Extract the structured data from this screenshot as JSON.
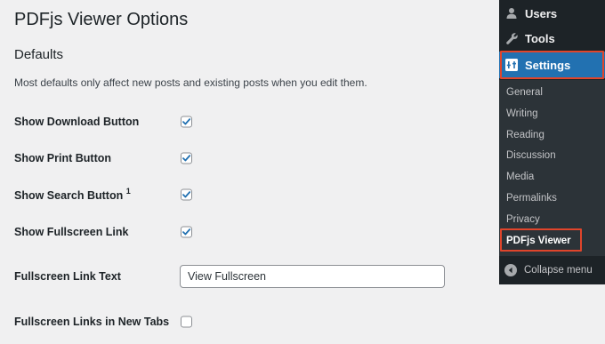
{
  "page": {
    "title": "PDFjs Viewer Options",
    "section_title": "Defaults",
    "section_description": "Most defaults only affect new posts and existing posts when you edit them."
  },
  "settings": [
    {
      "label": "Show Download Button",
      "type": "checkbox",
      "checked": true
    },
    {
      "label": "Show Print Button",
      "type": "checkbox",
      "checked": true
    },
    {
      "label": "Show Search Button",
      "footnote": "1",
      "type": "checkbox",
      "checked": true
    },
    {
      "label": "Show Fullscreen Link",
      "type": "checkbox",
      "checked": true
    },
    {
      "label": "Fullscreen Link Text",
      "type": "text",
      "value": "View Fullscreen"
    },
    {
      "label": "Fullscreen Links in New Tabs",
      "type": "checkbox",
      "checked": false
    }
  ],
  "sidebar": {
    "menu": [
      {
        "label": "Users",
        "icon": "users-icon"
      },
      {
        "label": "Tools",
        "icon": "wrench-icon"
      },
      {
        "label": "Settings",
        "icon": "settings-icon",
        "active": true
      }
    ],
    "submenu": [
      {
        "label": "General"
      },
      {
        "label": "Writing"
      },
      {
        "label": "Reading"
      },
      {
        "label": "Discussion"
      },
      {
        "label": "Media"
      },
      {
        "label": "Permalinks"
      },
      {
        "label": "Privacy"
      },
      {
        "label": "PDFjs Viewer",
        "current": true
      }
    ],
    "collapse_label": "Collapse menu",
    "collapse_icon": "collapse-arrow-icon"
  },
  "colors": {
    "accent": "#2271b1",
    "sidebar_bg": "#1d2327",
    "submenu_bg": "#2c3338",
    "highlight": "#e0452b",
    "checkmark": "#2271b1",
    "page_bg": "#f0f0f1"
  }
}
